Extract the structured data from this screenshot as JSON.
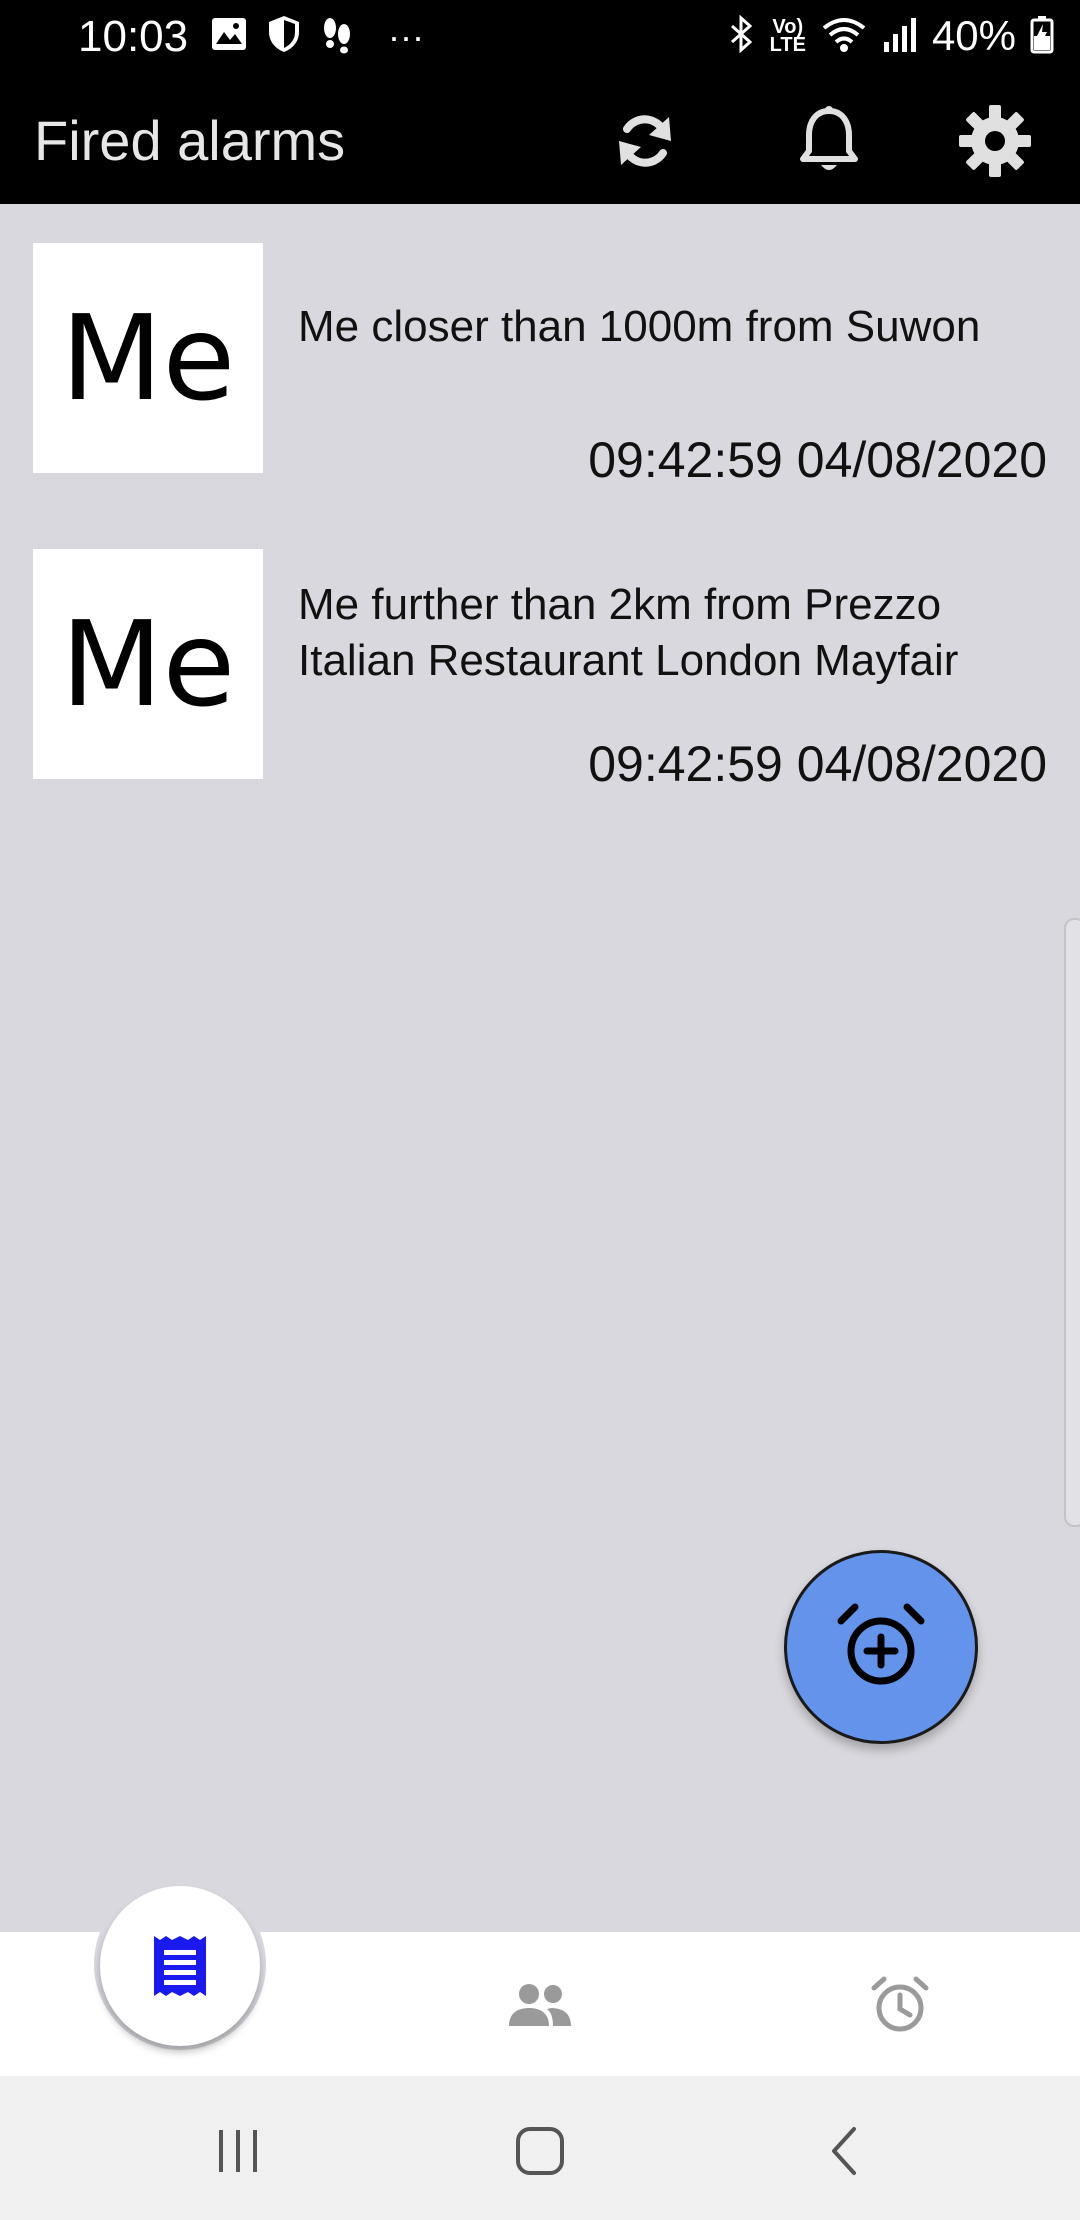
{
  "status_bar": {
    "time": "10:03",
    "battery": "40%",
    "volte_top": "Vo)",
    "volte_bottom": "LTE",
    "more": "···"
  },
  "app_bar": {
    "title": "Fired alarms",
    "refresh_icon": "refresh-icon",
    "bell_icon": "bell-icon",
    "settings_icon": "gear-icon"
  },
  "alarms": [
    {
      "avatar": "Me",
      "text": "Me closer than 1000m from Suwon",
      "time": "09:42:59 04/08/2020"
    },
    {
      "avatar": "Me",
      "text": "Me further than 2km from Prezzo Italian Restaurant London Mayfair",
      "time": "09:42:59 04/08/2020"
    }
  ],
  "fab": {
    "icon": "add-alarm-icon"
  },
  "bottom_nav": {
    "items": [
      {
        "name": "fired-alarms",
        "icon": "receipt-icon",
        "active": true
      },
      {
        "name": "people",
        "icon": "people-icon",
        "active": false
      },
      {
        "name": "alarms",
        "icon": "alarm-clock-icon",
        "active": false
      }
    ]
  },
  "colors": {
    "background": "#d8d8de",
    "bar": "#000000",
    "fab": "#6393ea",
    "active_nav": "#1a1af0",
    "inactive_nav": "#9a9a9a"
  }
}
